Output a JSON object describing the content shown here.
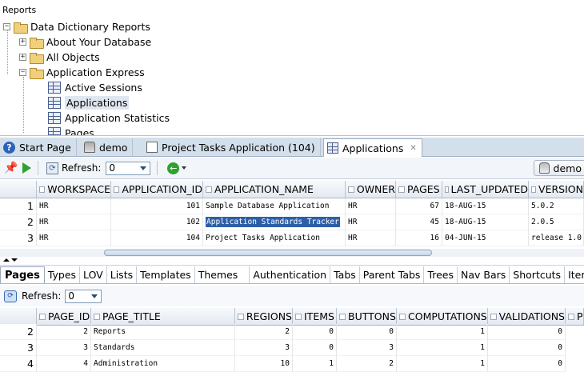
{
  "tree": {
    "title": "Reports",
    "items": [
      {
        "label": "Data Dictionary Reports",
        "level": 0,
        "expander": "−",
        "icon": "folder-open-icon"
      },
      {
        "label": "About Your Database",
        "level": 1,
        "expander": "+",
        "icon": "folder-icon"
      },
      {
        "label": "All Objects",
        "level": 1,
        "expander": "+",
        "icon": "folder-icon"
      },
      {
        "label": "Application Express",
        "level": 1,
        "expander": "−",
        "icon": "folder-open-icon"
      },
      {
        "label": "Active Sessions",
        "level": 2,
        "icon": "report-grid-icon"
      },
      {
        "label": "Applications",
        "level": 2,
        "icon": "report-grid-icon",
        "selected": true
      },
      {
        "label": "Application Statistics",
        "level": 2,
        "icon": "report-grid-icon"
      },
      {
        "label": "Pages",
        "level": 2,
        "icon": "report-grid-icon"
      }
    ]
  },
  "tabs": [
    {
      "label": "Start Page",
      "icon": "help-icon"
    },
    {
      "label": "demo",
      "icon": "database-icon"
    },
    {
      "label": "Project Tasks Application (104)",
      "icon": "page-icon"
    },
    {
      "label": "Applications",
      "icon": "report-icon",
      "active": true,
      "close": "✕"
    }
  ],
  "toolbar": {
    "refresh_label": "Refresh:",
    "refresh_value": "0",
    "connection": "demo"
  },
  "grid1": {
    "columns": [
      "WORKSPACE",
      "APPLICATION_ID",
      "APPLICATION_NAME",
      "OWNER",
      "PAGES",
      "LAST_UPDATED",
      "VERSION"
    ],
    "rows": [
      {
        "n": "1",
        "cells": [
          "HR",
          "101",
          "Sample Database Application",
          "HR",
          "67",
          "18-AUG-15",
          "5.0.2"
        ]
      },
      {
        "n": "2",
        "cells": [
          "HR",
          "102",
          "Application Standards Tracker",
          "HR",
          "45",
          "18-AUG-15",
          "2.0.5"
        ]
      },
      {
        "n": "3",
        "cells": [
          "HR",
          "104",
          "Project Tasks Application",
          "HR",
          "16",
          "04-JUN-15",
          "release 1.0"
        ]
      }
    ]
  },
  "subtabs": [
    "Pages",
    "Types",
    "LOV",
    "Lists",
    "Templates",
    "Themes",
    "Authentication",
    "Tabs",
    "Parent Tabs",
    "Trees",
    "Nav Bars",
    "Shortcuts",
    "Items"
  ],
  "toolbar2": {
    "refresh_label": "Refresh:",
    "refresh_value": "0"
  },
  "grid2": {
    "columns": [
      "PAGE_ID",
      "PAGE_TITLE",
      "REGIONS",
      "ITEMS",
      "BUTTONS",
      "COMPUTATIONS",
      "VALIDATIONS",
      "P"
    ],
    "rows": [
      {
        "n": "2",
        "cells": [
          "2",
          "Reports",
          "2",
          "0",
          "0",
          "1",
          "0"
        ]
      },
      {
        "n": "3",
        "cells": [
          "3",
          "Standards",
          "3",
          "0",
          "3",
          "1",
          "0"
        ]
      },
      {
        "n": "4",
        "cells": [
          "4",
          "Administration",
          "10",
          "1",
          "2",
          "1",
          "0"
        ]
      }
    ]
  }
}
